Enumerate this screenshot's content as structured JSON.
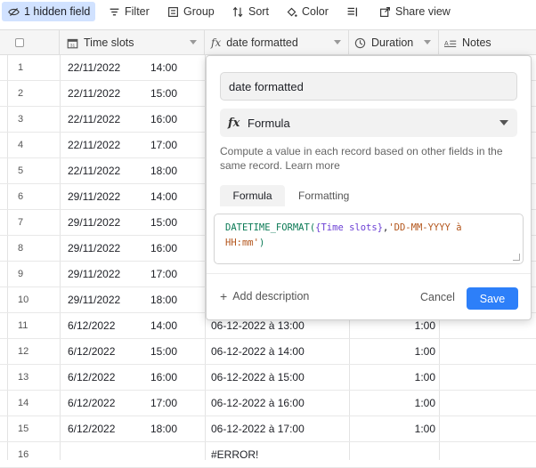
{
  "toolbar": {
    "hidden_fields": "1 hidden field",
    "filter": "Filter",
    "group": "Group",
    "sort": "Sort",
    "color": "Color",
    "share_view": "Share view"
  },
  "columns": {
    "time_slots": "Time slots",
    "date_formatted": "date formatted",
    "duration": "Duration",
    "notes": "Notes"
  },
  "rows": [
    {
      "num": "1",
      "date": "22/11/2022",
      "time": "14:00",
      "formatted": "",
      "duration": ""
    },
    {
      "num": "2",
      "date": "22/11/2022",
      "time": "15:00",
      "formatted": "",
      "duration": ""
    },
    {
      "num": "3",
      "date": "22/11/2022",
      "time": "16:00",
      "formatted": "",
      "duration": ""
    },
    {
      "num": "4",
      "date": "22/11/2022",
      "time": "17:00",
      "formatted": "",
      "duration": ""
    },
    {
      "num": "5",
      "date": "22/11/2022",
      "time": "18:00",
      "formatted": "",
      "duration": ""
    },
    {
      "num": "6",
      "date": "29/11/2022",
      "time": "14:00",
      "formatted": "",
      "duration": ""
    },
    {
      "num": "7",
      "date": "29/11/2022",
      "time": "15:00",
      "formatted": "",
      "duration": ""
    },
    {
      "num": "8",
      "date": "29/11/2022",
      "time": "16:00",
      "formatted": "",
      "duration": ""
    },
    {
      "num": "9",
      "date": "29/11/2022",
      "time": "17:00",
      "formatted": "",
      "duration": ""
    },
    {
      "num": "10",
      "date": "29/11/2022",
      "time": "18:00",
      "formatted": "",
      "duration": ""
    },
    {
      "num": "11",
      "date": "6/12/2022",
      "time": "14:00",
      "formatted": "06-12-2022 à 13:00",
      "duration": "1:00"
    },
    {
      "num": "12",
      "date": "6/12/2022",
      "time": "15:00",
      "formatted": "06-12-2022 à 14:00",
      "duration": "1:00"
    },
    {
      "num": "13",
      "date": "6/12/2022",
      "time": "16:00",
      "formatted": "06-12-2022 à 15:00",
      "duration": "1:00"
    },
    {
      "num": "14",
      "date": "6/12/2022",
      "time": "17:00",
      "formatted": "06-12-2022 à 16:00",
      "duration": "1:00"
    },
    {
      "num": "15",
      "date": "6/12/2022",
      "time": "18:00",
      "formatted": "06-12-2022 à 17:00",
      "duration": "1:00"
    },
    {
      "num": "16",
      "date": "",
      "time": "",
      "formatted": "#ERROR!",
      "duration": ""
    }
  ],
  "popup": {
    "field_name": "date formatted",
    "field_type": "Formula",
    "description": "Compute a value in each record based on other fields in the same record.",
    "learn_more": "Learn more",
    "tab_formula": "Formula",
    "tab_formatting": "Formatting",
    "formula": {
      "fn": "DATETIME_FORMAT(",
      "field": "{Time slots}",
      "comma": ",",
      "format_line1": "'DD-MM-YYYY à",
      "format_line2": "HH:mm'",
      "close": ")"
    },
    "add_description": "Add description",
    "cancel": "Cancel",
    "save": "Save"
  },
  "colors": {
    "accent": "#2d7ff9",
    "active_tab_bg": "#d1e2ff",
    "header_bg": "#f5f5f5"
  }
}
